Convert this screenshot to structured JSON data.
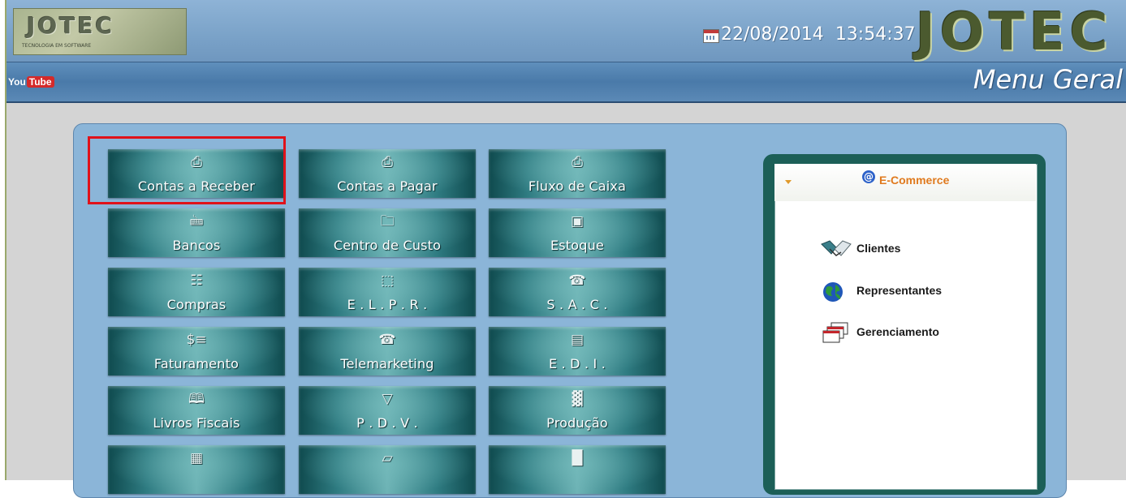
{
  "header": {
    "logo_text": "JOTEC",
    "logo_sub": "TECNOLOGIA EM SOFTWARE",
    "date": "22/08/2014",
    "time": "13:54:37",
    "brand": "JOTEC"
  },
  "titlebar": {
    "youtube_you": "You",
    "youtube_tube": "Tube",
    "title": "Menu Geral"
  },
  "tiles": [
    {
      "label": "Contas a Receber",
      "icon": "printer-icon"
    },
    {
      "label": "Contas a Pagar",
      "icon": "printer-icon"
    },
    {
      "label": "Fluxo de Caixa",
      "icon": "printer-icon"
    },
    {
      "label": "Bancos",
      "icon": "bank-icon"
    },
    {
      "label": "Centro de Custo",
      "icon": "folder-icon"
    },
    {
      "label": "Estoque",
      "icon": "box-icon"
    },
    {
      "label": "Compras",
      "icon": "cart-icon"
    },
    {
      "label": "E . L . P . R .",
      "icon": "network-icon"
    },
    {
      "label": "S . A . C .",
      "icon": "phone-icon"
    },
    {
      "label": "Faturamento",
      "icon": "invoice-icon"
    },
    {
      "label": "Telemarketing",
      "icon": "telephone-icon"
    },
    {
      "label": "E . D . I .",
      "icon": "edi-icon"
    },
    {
      "label": "Livros Fiscais",
      "icon": "books-icon"
    },
    {
      "label": "P . D . V .",
      "icon": "pos-icon"
    },
    {
      "label": "Produção",
      "icon": "factory-icon"
    },
    {
      "label": "",
      "icon": "calculator-icon"
    },
    {
      "label": "",
      "icon": "document-icon"
    },
    {
      "label": "",
      "icon": "building-icon"
    }
  ],
  "ecommerce": {
    "title": "E-Commerce",
    "items": [
      {
        "label": "Clientes",
        "icon": "handshake-icon"
      },
      {
        "label": "Representantes",
        "icon": "globe-icon"
      },
      {
        "label": "Gerenciamento",
        "icon": "windows-icon"
      }
    ]
  },
  "colors": {
    "highlight": "#e0121a",
    "ecommerce_title": "#e07a1e",
    "tile_dark": "#0f4a4e",
    "tile_light": "#6db3b5"
  }
}
